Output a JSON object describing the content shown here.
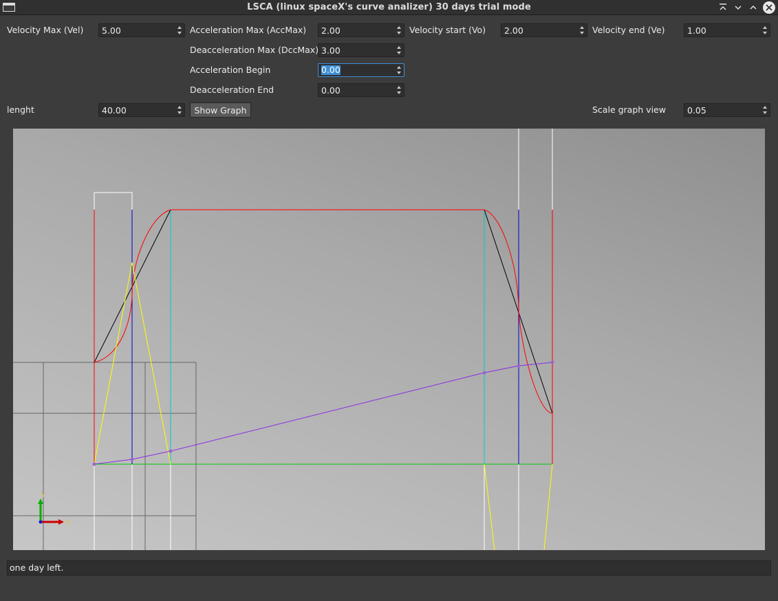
{
  "window": {
    "title": "LSCA (linux spaceX's curve analizer) 30 days trial mode",
    "icon": "app-window-icon",
    "controls": [
      "keep-above-icon",
      "minimize-icon",
      "maximize-icon",
      "close-icon"
    ]
  },
  "fields": {
    "velocity_max": {
      "label": "Velocity Max (Vel)",
      "value": "5.00"
    },
    "acceleration_max": {
      "label": "Acceleration Max (AccMax)",
      "value": "2.00"
    },
    "velocity_start": {
      "label": "Velocity start (Vo)",
      "value": "2.00"
    },
    "velocity_end": {
      "label": "Velocity end (Ve)",
      "value": "1.00"
    },
    "deacceleration_max": {
      "label": "Deacceleration Max (DccMax)",
      "value": "3.00"
    },
    "acceleration_begin": {
      "label": "Acceleration Begin",
      "value": "0.00"
    },
    "deacceleration_end": {
      "label": "Deacceleration End",
      "value": "0.00"
    },
    "lenght": {
      "label": "lenght",
      "value": "40.00"
    },
    "scale_graph_view": {
      "label": "Scale graph view",
      "value": "0.05"
    }
  },
  "buttons": {
    "show_graph": "Show Graph"
  },
  "graph": {
    "axis_labels": {
      "x": "X",
      "y": "Y"
    },
    "colors": {
      "boundary": "#ff0000",
      "accel_end_marker": "#0000cc",
      "cruise_marker": "#00cccc",
      "velocity_curve": "#cc0000",
      "linear_velocity": "#000000",
      "acceleration": "#ffff00",
      "position": "#8a2be2",
      "baseline": "#00cc00",
      "guides": "#ffffff",
      "grid": "#606060"
    }
  },
  "status": {
    "text": "one day left."
  }
}
